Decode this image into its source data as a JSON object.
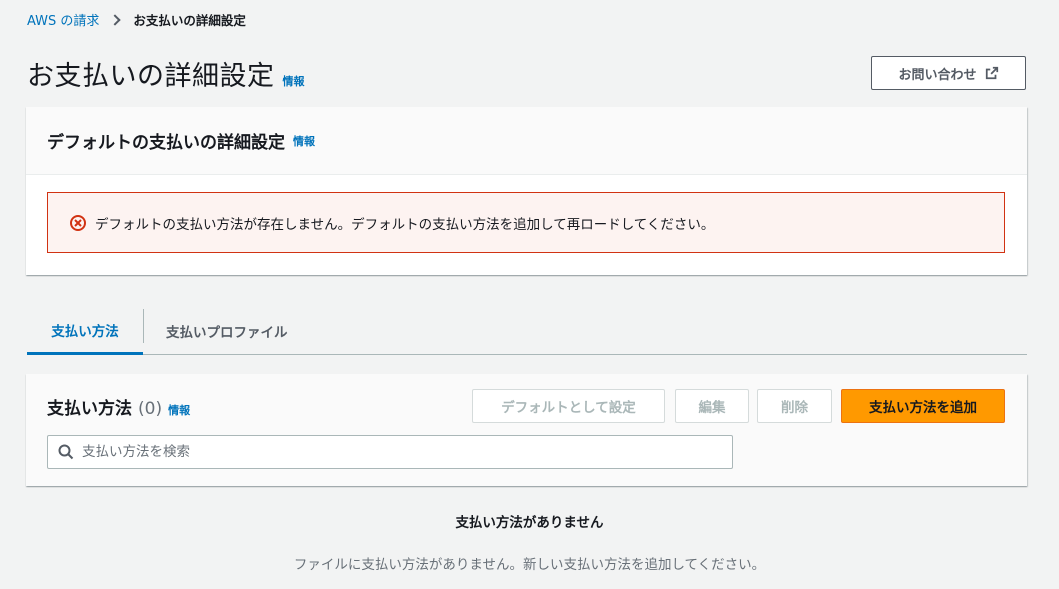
{
  "breadcrumb": {
    "root": "AWS の請求",
    "current": "お支払いの詳細設定"
  },
  "page": {
    "title": "お支払いの詳細設定",
    "info": "情報",
    "contact_button": "お問い合わせ"
  },
  "default_panel": {
    "title": "デフォルトの支払いの詳細設定",
    "info": "情報",
    "error_message": "デフォルトの支払い方法が存在しません。デフォルトの支払い方法を追加して再ロードしてください。"
  },
  "tabs": [
    {
      "label": "支払い方法",
      "active": true
    },
    {
      "label": "支払いプロファイル",
      "active": false
    }
  ],
  "methods_panel": {
    "title": "支払い方法",
    "count": "(0)",
    "info": "情報",
    "buttons": {
      "set_default": "デフォルトとして設定",
      "edit": "編集",
      "delete": "削除",
      "add": "支払い方法を追加"
    },
    "search_placeholder": "支払い方法を検索"
  },
  "empty_state": {
    "title": "支払い方法がありません",
    "description": "ファイルに支払い方法がありません。新しい支払い方法を追加してください。"
  },
  "colors": {
    "link": "#0073bb",
    "primary": "#ff9900",
    "error": "#d13212",
    "background": "#f2f3f3"
  }
}
